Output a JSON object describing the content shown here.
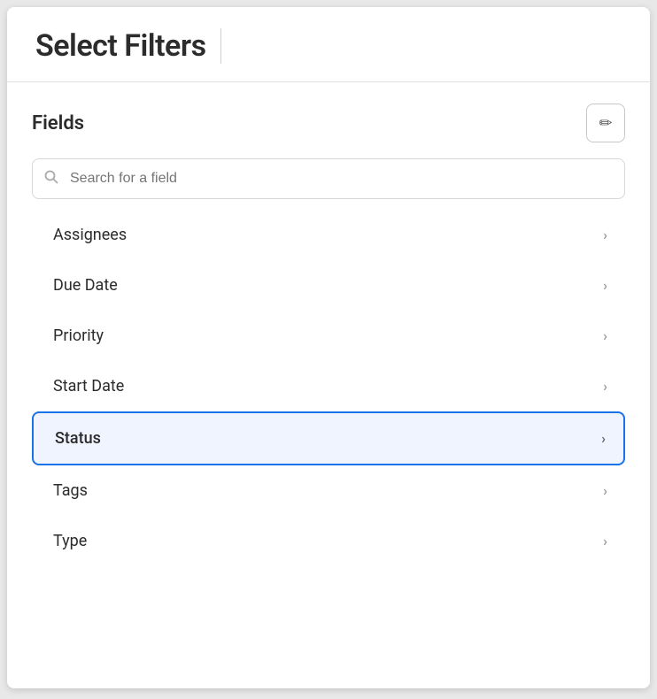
{
  "header": {
    "title": "Select Filters"
  },
  "fields_section": {
    "label": "Fields",
    "edit_button_label": "edit",
    "search_placeholder": "Search for a field"
  },
  "field_items": [
    {
      "id": "assignees",
      "label": "Assignees",
      "active": false
    },
    {
      "id": "due-date",
      "label": "Due Date",
      "active": false
    },
    {
      "id": "priority",
      "label": "Priority",
      "active": false
    },
    {
      "id": "start-date",
      "label": "Start Date",
      "active": false
    },
    {
      "id": "status",
      "label": "Status",
      "active": true
    },
    {
      "id": "tags",
      "label": "Tags",
      "active": false
    },
    {
      "id": "type",
      "label": "Type",
      "active": false
    }
  ],
  "icons": {
    "edit": "✏",
    "search": "⌕",
    "chevron": "›"
  }
}
